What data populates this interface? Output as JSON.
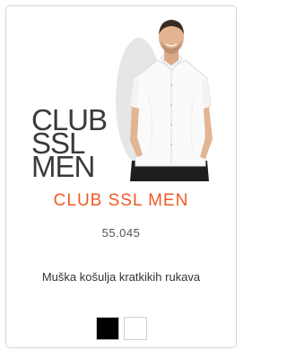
{
  "product": {
    "logo_lines": [
      "CLUB",
      "SSL",
      "MEN"
    ],
    "name": "CLUB SSL MEN",
    "code": "55.045",
    "description": "Muška košulja kratkikih rukava",
    "image_icon": "model-shirt-photo",
    "accent_color": "#f05a24",
    "colors": [
      {
        "name": "black",
        "hex": "#000000"
      },
      {
        "name": "white",
        "hex": "#ffffff"
      }
    ]
  }
}
